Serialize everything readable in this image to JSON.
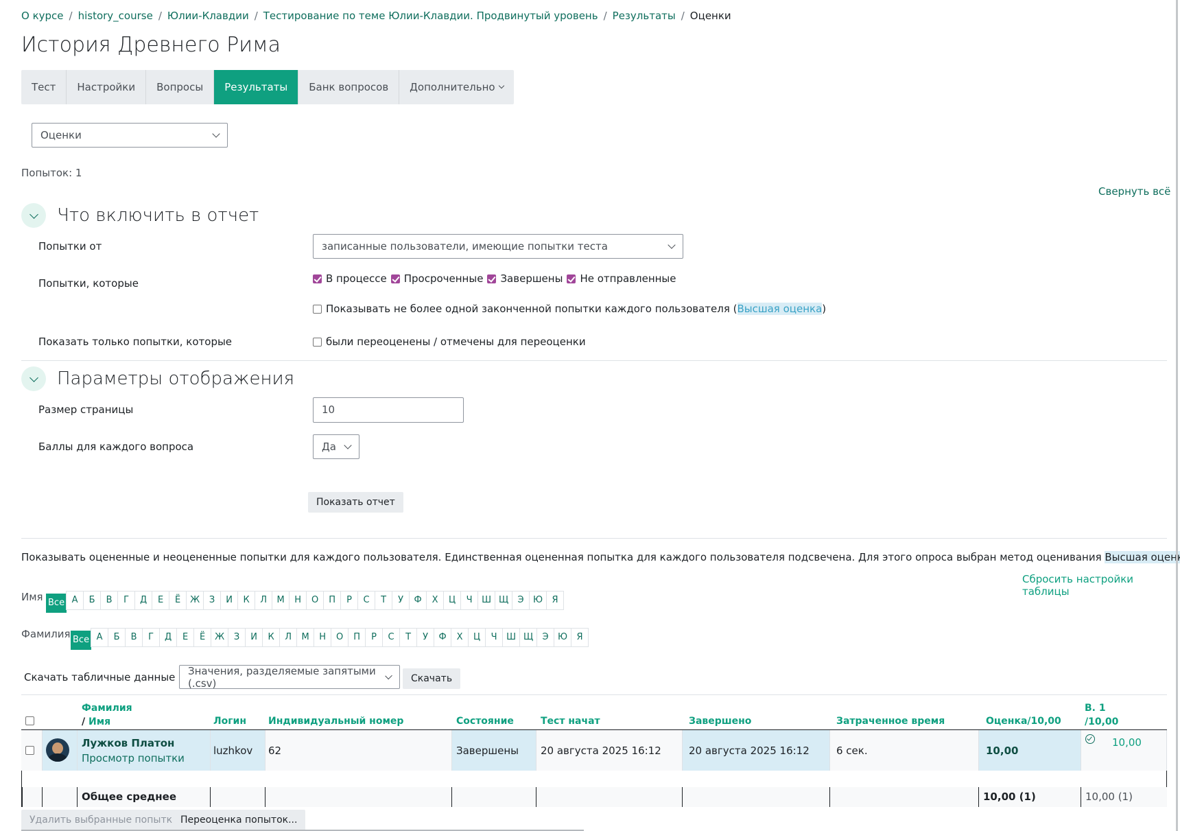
{
  "breadcrumb": [
    "О курсе",
    "history_course",
    "Юлии-Клавдии",
    "Тестирование по теме Юлии-Клавдии. Продвинутый уровень",
    "Результаты",
    "Оценки"
  ],
  "page_title": "История Древнего Рима",
  "tabs": [
    "Тест",
    "Настройки",
    "Вопросы",
    "Результаты",
    "Банк вопросов",
    "Дополнительно"
  ],
  "report_select": "Оценки",
  "attempts_count": "Попыток: 1",
  "collapse_all": "Свернуть всё",
  "section1": {
    "title": "Что включить в отчет",
    "attempts_from_label": "Попытки от",
    "attempts_from_value": "записанные пользователи, имеющие попытки теста",
    "attempts_which_label": "Попытки, которые",
    "states": [
      "В процессе",
      "Просроченные",
      "Завершены",
      "Не отправленные"
    ],
    "one_attempt_prefix": "Показывать не более одной законченной попытки каждого пользователя (",
    "one_attempt_link": "Высшая оценка",
    "one_attempt_suffix": ")",
    "only_attempts_label": "Показать только попытки, которые",
    "regraded_label": "были переоценены / отмечены для переоценки"
  },
  "section2": {
    "title": "Параметры отображения",
    "page_size_label": "Размер страницы",
    "page_size_value": "10",
    "marks_label": "Баллы для каждого вопроса",
    "marks_value": "Да",
    "show_report": "Показать отчет"
  },
  "info_text": "Показывать оцененные и неоцененные попытки для каждого пользователя. Единственная оцененная попытка для каждого пользователя подсвечена. Для этого опроса выбран метод оценивания ",
  "info_link": "Высшая оценка",
  "info_end": ".",
  "reset_table": "Сбросить настройки таблицы",
  "firstname_label": "Имя",
  "lastname_label": "Фамилия",
  "all_label": "Все",
  "letters": [
    "А",
    "Б",
    "В",
    "Г",
    "Д",
    "Е",
    "Ё",
    "Ж",
    "З",
    "И",
    "К",
    "Л",
    "М",
    "Н",
    "О",
    "П",
    "Р",
    "С",
    "Т",
    "У",
    "Ф",
    "Х",
    "Ц",
    "Ч",
    "Ш",
    "Щ",
    "Э",
    "Ю",
    "Я"
  ],
  "download_label": "Скачать табличные данные как",
  "download_format": "Значения, разделяемые запятыми (.csv)",
  "download_button": "Скачать",
  "table": {
    "headers": {
      "surname": "Фамилия",
      "name_sep": "/ ",
      "name": "Имя",
      "login": "Логин",
      "idnumber": "Индивидуальный номер",
      "state": "Состояние",
      "started": "Тест начат",
      "finished": "Завершено",
      "duration": "Затраченное время",
      "grade": "Оценка/10,00",
      "q1_line1": "В. 1",
      "q1_line2": "/10,00"
    },
    "row": {
      "fullname": "Лужков Платон",
      "review": "Просмотр попытки",
      "login": "luzhkov",
      "idnumber": "62",
      "state": "Завершены",
      "started": "20 августа 2025 16:12",
      "finished": "20 августа 2025 16:12",
      "duration": "6 сек.",
      "grade": "10,00",
      "q1": "10,00"
    },
    "average": {
      "label": "Общее среднее",
      "grade": "10,00 (1)",
      "q1": "10,00 (1)"
    }
  },
  "bottom_buttons": [
    "Удалить выбранные попытки",
    "Переоценка попыток..."
  ],
  "colors": {
    "accent": "#0fa080",
    "link": "#0f6e5d",
    "checkbox": "#a14699",
    "highlight": "#d8ecf5"
  }
}
